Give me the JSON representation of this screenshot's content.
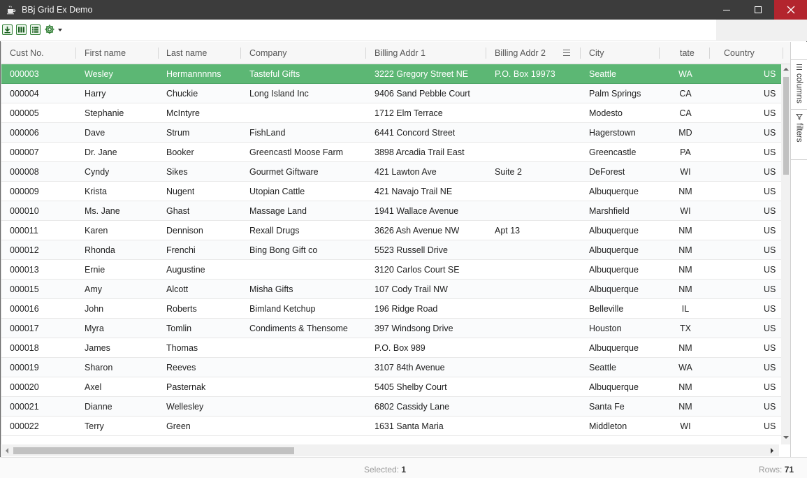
{
  "window": {
    "title": "BBj Grid Ex Demo",
    "app_icon": "coffee-cup-icon",
    "controls": [
      "minimize-icon",
      "maximize-icon",
      "close-icon"
    ]
  },
  "toolbar": {
    "buttons": [
      "download-icon",
      "columns-icon",
      "list-icon",
      "gear-icon",
      "caret-down-icon"
    ],
    "accent_color": "#2e7d32"
  },
  "grid": {
    "columns": [
      "Cust No.",
      "First name",
      "Last name",
      "Company",
      "Billing Addr 1",
      "Billing Addr 2",
      "City",
      "tate",
      "Country"
    ],
    "selected_color": "#5cb774",
    "rows": [
      [
        "000003",
        "Wesley",
        "Hermannnnns",
        "Tasteful Gifts",
        "3222 Gregory Street NE",
        "P.O. Box 19973",
        "Seattle",
        "WA",
        "US"
      ],
      [
        "000004",
        "Harry",
        "Chuckie",
        "Long Island Inc",
        "9406 Sand Pebble Court",
        "",
        "Palm Springs",
        "CA",
        "US"
      ],
      [
        "000005",
        "Stephanie",
        "McIntyre",
        "",
        "1712 Elm Terrace",
        "",
        "Modesto",
        "CA",
        "US"
      ],
      [
        "000006",
        "Dave",
        "Strum",
        "FishLand",
        "6441 Concord Street",
        "",
        "Hagerstown",
        "MD",
        "US"
      ],
      [
        "000007",
        "Dr. Jane",
        "Booker",
        "Greencastl Moose Farm",
        "3898 Arcadia Trail East",
        "",
        "Greencastle",
        "PA",
        "US"
      ],
      [
        "000008",
        "Cyndy",
        "Sikes",
        "Gourmet Giftware",
        "421 Lawton Ave",
        "Suite 2",
        "DeForest",
        "WI",
        "US"
      ],
      [
        "000009",
        "Krista",
        "Nugent",
        "Utopian Cattle",
        "421 Navajo Trail NE",
        "",
        "Albuquerque",
        "NM",
        "US"
      ],
      [
        "000010",
        "Ms. Jane",
        "Ghast",
        "Massage Land",
        "1941 Wallace Avenue",
        "",
        "Marshfield",
        "WI",
        "US"
      ],
      [
        "000011",
        "Karen",
        "Dennison",
        "Rexall Drugs",
        "3626 Ash Avenue NW",
        "Apt 13",
        "Albuquerque",
        "NM",
        "US"
      ],
      [
        "000012",
        "Rhonda",
        "Frenchi",
        "Bing Bong Gift co",
        "5523 Russell Drive",
        "",
        "Albuquerque",
        "NM",
        "US"
      ],
      [
        "000013",
        "Ernie",
        "Augustine",
        "",
        "3120 Carlos Court SE",
        "",
        "Albuquerque",
        "NM",
        "US"
      ],
      [
        "000015",
        "Amy",
        "Alcott",
        "Misha Gifts",
        "107 Cody Trail NW",
        "",
        "Albuquerque",
        "NM",
        "US"
      ],
      [
        "000016",
        "John",
        "Roberts",
        "Bimland Ketchup",
        "196 Ridge Road",
        "",
        "Belleville",
        "IL",
        "US"
      ],
      [
        "000017",
        "Myra",
        "Tomlin",
        "Condiments & Thensome",
        "397 Windsong Drive",
        "",
        "Houston",
        "TX",
        "US"
      ],
      [
        "000018",
        "James",
        "Thomas",
        "",
        "P.O. Box 989",
        "",
        "Albuquerque",
        "NM",
        "US"
      ],
      [
        "000019",
        "Sharon",
        "Reeves",
        "",
        "3107 84th Avenue",
        "",
        "Seattle",
        "WA",
        "US"
      ],
      [
        "000020",
        "Axel",
        "Pasternak",
        "",
        "5405 Shelby Court",
        "",
        "Albuquerque",
        "NM",
        "US"
      ],
      [
        "000021",
        "Dianne",
        "Wellesley",
        "",
        "6802 Cassidy Lane",
        "",
        "Santa Fe",
        "NM",
        "US"
      ],
      [
        "000022",
        "Terry",
        "Green",
        "",
        "1631 Santa Maria",
        "",
        "Middleton",
        "WI",
        "US"
      ]
    ]
  },
  "side_panel": {
    "columns_label": "columns",
    "filters_label": "filters"
  },
  "status": {
    "selected_label": "Selected:",
    "selected_count": "1",
    "rows_label": "Rows:",
    "rows_count": "71"
  }
}
